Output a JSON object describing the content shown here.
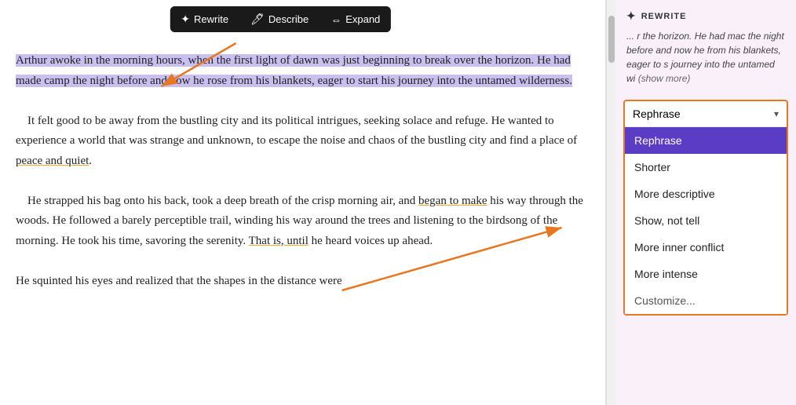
{
  "toolbar": {
    "rewrite_label": "Rewrite",
    "describe_label": "Describe",
    "expand_label": "Expand"
  },
  "editor": {
    "paragraph1": "Arthur awoke in the morning hours, when the first light of dawn was just beginning to break over the horizon. He had made camp the night before and now he rose from his blankets, eager to start his journey into the untamed wilderness.",
    "paragraph2": "It felt good to be away from the bustling city and its political intrigues, seeking solace and refuge. He wanted to experience a world that was strange and unknown, to escape the noise and chaos of the bustling city and find a place of peace and quiet.",
    "paragraph3": "He strapped his bag onto his back, took a deep breath of the crisp morning air, and began to make his way through the woods. He followed a barely perceptible trail, winding his way around the trees and listening to the birdsong of the morning. He took his time, savoring the serenity. That is, until he heard voices up ahead.",
    "paragraph4": "He squinted his eyes and realized that the shapes in the distance were"
  },
  "right_panel": {
    "section_title": "REWRITE",
    "rewrite_preview": "... r the horizon. He had mac the night before and now he from his blankets, eager to s journey into the untamed wi",
    "show_more": "(show more)",
    "dropdown": {
      "selected": "Rephrase",
      "chevron": "▾",
      "options": [
        {
          "label": "Rephrase",
          "active": true
        },
        {
          "label": "Shorter",
          "active": false
        },
        {
          "label": "More descriptive",
          "active": false
        },
        {
          "label": "Show, not tell",
          "active": false
        },
        {
          "label": "More inner conflict",
          "active": false
        },
        {
          "label": "More intense",
          "active": false
        },
        {
          "label": "Customize...",
          "active": false
        }
      ]
    }
  }
}
